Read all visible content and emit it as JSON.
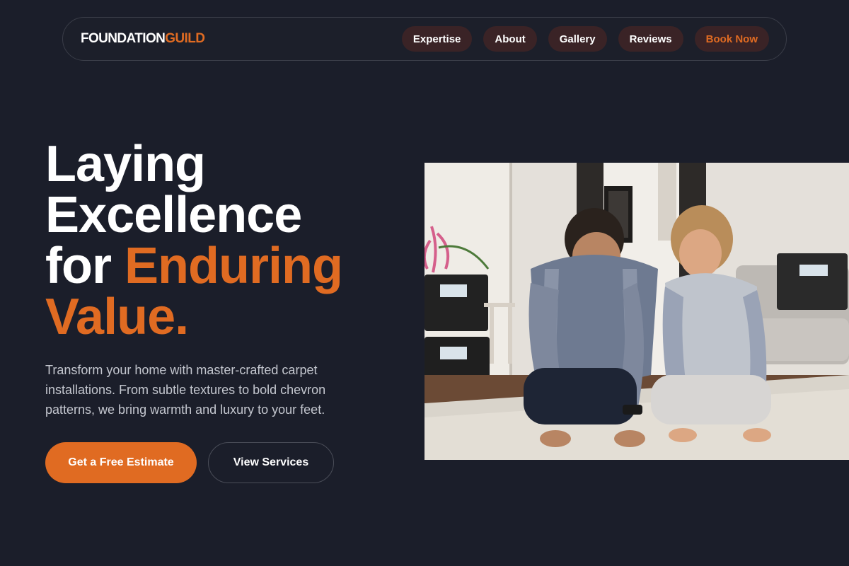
{
  "brand": {
    "part1": "FOUNDATION",
    "part2": "GUILD"
  },
  "nav": {
    "items": [
      {
        "label": "Expertise"
      },
      {
        "label": "About"
      },
      {
        "label": "Gallery"
      },
      {
        "label": "Reviews"
      }
    ],
    "cta": "Book Now"
  },
  "hero": {
    "title_line1": "Laying",
    "title_line2": "Excellence",
    "title_line3_plain": "for ",
    "title_line3_accent": "Enduring",
    "title_line4_accent": "Value.",
    "description": "Transform your home with master-crafted carpet installations. From subtle textures to bold chevron patterns, we bring warmth and luxury to your feet.",
    "primary_button": "Get a Free Estimate",
    "secondary_button": "View Services",
    "image_alt": "Couple inspecting new carpet"
  },
  "colors": {
    "background": "#1b1e2a",
    "accent": "#e06b22",
    "nav_pill": "#3a2326"
  }
}
